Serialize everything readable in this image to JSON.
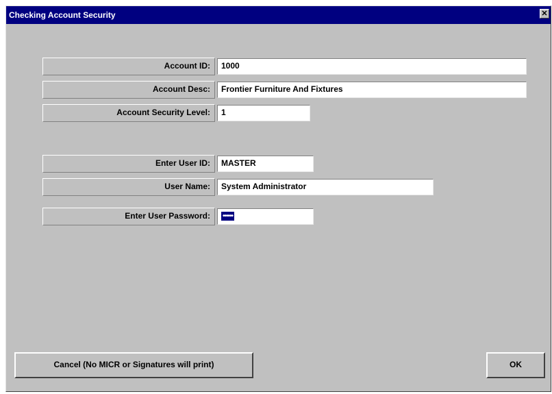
{
  "window": {
    "title": "Checking Account Security",
    "close_glyph": "✕"
  },
  "fields": {
    "account_id": {
      "label": "Account ID:",
      "value": "1000"
    },
    "account_desc": {
      "label": "Account Desc:",
      "value": "Frontier Furniture And Fixtures"
    },
    "security_level": {
      "label": "Account Security Level:",
      "value": "1"
    },
    "user_id": {
      "label": "Enter User ID:",
      "value": "MASTER"
    },
    "user_name": {
      "label": "User Name:",
      "value": "System Administrator"
    },
    "password": {
      "label": "Enter User Password:",
      "value": "••••••"
    }
  },
  "buttons": {
    "cancel_label": "Cancel (No MICR or Signatures will print)",
    "ok_label": "OK"
  },
  "colors": {
    "title_bar": "#000080",
    "dialog_face": "#c0c0c0",
    "selection": "#000080"
  }
}
